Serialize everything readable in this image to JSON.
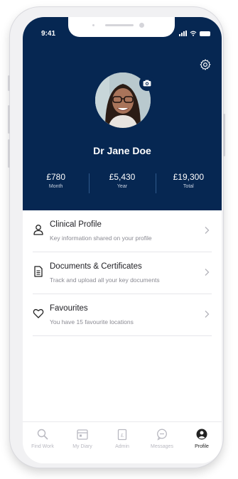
{
  "status_bar": {
    "time": "9:41"
  },
  "profile": {
    "name": "Dr Jane Doe"
  },
  "stats": [
    {
      "value": "£780",
      "label": "Month"
    },
    {
      "value": "£5,430",
      "label": "Year"
    },
    {
      "value": "£19,300",
      "label": "Total"
    }
  ],
  "menu": [
    {
      "title": "Clinical Profile",
      "subtitle": "Key information shared on your profile",
      "icon": "user-icon"
    },
    {
      "title": "Documents & Certificates",
      "subtitle": "Track and upload all your key documents",
      "icon": "document-icon"
    },
    {
      "title": "Favourites",
      "subtitle": "You have 15 favourite locations",
      "icon": "heart-icon"
    }
  ],
  "tabs": [
    {
      "label": "Find Work",
      "icon": "search-icon",
      "active": false
    },
    {
      "label": "My Diary",
      "icon": "calendar-icon",
      "active": false
    },
    {
      "label": "Admin",
      "icon": "clipboard-icon",
      "active": false
    },
    {
      "label": "Messages",
      "icon": "chat-icon",
      "active": false
    },
    {
      "label": "Profile",
      "icon": "profile-icon",
      "active": true
    }
  ],
  "colors": {
    "header": "#062752",
    "active_tab": "#222222",
    "inactive_tab": "#b8b8c0"
  }
}
